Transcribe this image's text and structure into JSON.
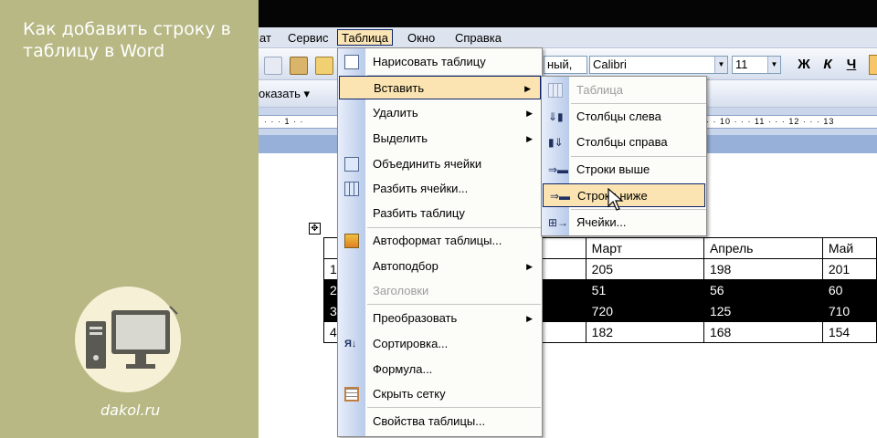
{
  "brand": {
    "title": "Как добавить строку в таблицу в Word",
    "site": "dakol.ru"
  },
  "menubar": {
    "items": [
      "ат",
      "Сервис",
      "Таблица",
      "Окно",
      "Справка"
    ]
  },
  "toolbar": {
    "style_value": "ный,",
    "font_value": "Calibri",
    "size_value": "11",
    "bold": "Ж",
    "italic": "К",
    "underline": "Ч",
    "show_label": "оказать ▾"
  },
  "ruler": {
    "left_marks": "· · · 1 · ·",
    "right_marks": "· · 10 · · · 11 · · · 12 · · · 13"
  },
  "table_menu": {
    "items": [
      {
        "label": "Нарисовать таблицу",
        "icon": "pencil-table-icon"
      },
      {
        "label": "Вставить",
        "submenu": true,
        "selected": true
      },
      {
        "label": "Удалить",
        "submenu": true
      },
      {
        "label": "Выделить",
        "submenu": true
      },
      {
        "label": "Объединить ячейки",
        "icon": "merge-cells-icon"
      },
      {
        "label": "Разбить ячейки...",
        "icon": "split-cells-icon"
      },
      {
        "label": "Разбить таблицу"
      },
      {
        "label": "Автоформат таблицы...",
        "icon": "autoformat-icon"
      },
      {
        "label": "Автоподбор",
        "submenu": true
      },
      {
        "label": "Заголовки",
        "disabled": true
      },
      {
        "label": "Преобразовать",
        "submenu": true
      },
      {
        "label": "Сортировка...",
        "icon": "sort-icon"
      },
      {
        "label": "Формула..."
      },
      {
        "label": "Скрыть сетку",
        "icon": "grid-icon"
      },
      {
        "label": "Свойства таблицы..."
      }
    ]
  },
  "insert_submenu": {
    "items": [
      {
        "label": "Таблица",
        "disabled": true,
        "icon": "table-icon"
      },
      {
        "label": "Столбцы слева",
        "icon": "columns-left-icon"
      },
      {
        "label": "Столбцы справа",
        "icon": "columns-right-icon"
      },
      {
        "label": "Строки выше",
        "icon": "rows-above-icon"
      },
      {
        "label": "Строки ниже",
        "icon": "rows-below-icon",
        "selected": true
      },
      {
        "label": "Ячейки...",
        "icon": "cells-icon"
      }
    ]
  },
  "doc_table": {
    "header": [
      "",
      "",
      "Март",
      "Апрель",
      "Май"
    ],
    "rows": [
      {
        "num": "1",
        "cells": [
          "205",
          "198",
          "201"
        ],
        "highlighted": false
      },
      {
        "num": "2",
        "cells": [
          "51",
          "56",
          "60"
        ],
        "highlighted": true
      },
      {
        "num": "3",
        "cells": [
          "720",
          "125",
          "710"
        ],
        "highlighted": true
      },
      {
        "num": "4",
        "cells": [
          "182",
          "168",
          "154"
        ],
        "highlighted": false
      }
    ]
  },
  "colors": {
    "sidebar": "#b7b884",
    "menu_highlight": "#fbe4b1",
    "menu_border": "#0a246a"
  }
}
